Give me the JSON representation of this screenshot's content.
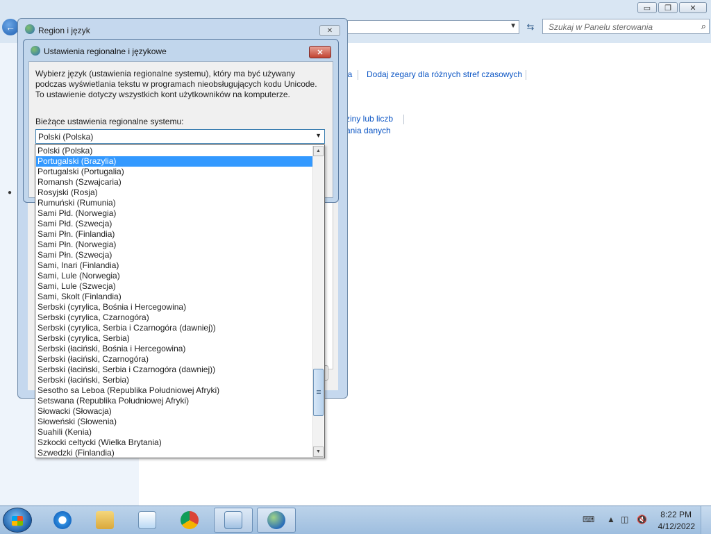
{
  "control_panel": {
    "search_placeholder": "Szukaj w Panelu sterowania",
    "links": {
      "add_clocks": "Dodaj zegary dla różnych stref czasowych",
      "partial_a": "ja",
      "partial_b": "ziny lub liczb",
      "partial_c": "ania danych"
    },
    "window_buttons": {
      "minimize": "▭",
      "restore": "❐",
      "close": "✕"
    }
  },
  "region_dialog": {
    "title": "Region i język",
    "close_glyph": "✕"
  },
  "regional_dialog": {
    "title": "Ustawienia regionalne i językowe",
    "close_glyph": "✕",
    "description": "Wybierz język (ustawienia regionalne systemu), który ma być używany podczas wyświetlania tekstu w programach nieobsługujących kodu Unicode. To ustawienie dotyczy wszystkich kont użytkowników na komputerze.",
    "current_label": "Bieżące ustawienia regionalne systemu:",
    "current_value": "Polski (Polska)"
  },
  "dropdown": {
    "selected_index": 1,
    "options": [
      "Polski (Polska)",
      "Portugalski (Brazylia)",
      "Portugalski (Portugalia)",
      "Romansh (Szwajcaria)",
      "Rosyjski (Rosja)",
      "Rumuński (Rumunia)",
      "Sami Płd. (Norwegia)",
      "Sami Płd. (Szwecja)",
      "Sami Płn. (Finlandia)",
      "Sami Płn. (Norwegia)",
      "Sami Płn. (Szwecja)",
      "Sami, Inari (Finlandia)",
      "Sami, Lule (Norwegia)",
      "Sami, Lule (Szwecja)",
      "Sami, Skolt (Finlandia)",
      "Serbski (cyrylica, Bośnia i Hercegowina)",
      "Serbski (cyrylica, Czarnogóra)",
      "Serbski (cyrylica, Serbia i Czarnogóra (dawniej))",
      "Serbski (cyrylica, Serbia)",
      "Serbski (łaciński, Bośnia i Hercegowina)",
      "Serbski (łaciński, Czarnogóra)",
      "Serbski (łaciński, Serbia i Czarnogóra (dawniej))",
      "Serbski (łaciński, Serbia)",
      "Sesotho sa Leboa (Republika Południowej Afryki)",
      "Setswana (Republika Południowej Afryki)",
      "Słowacki (Słowacja)",
      "Słoweński (Słowenia)",
      "Suahili (Kenia)",
      "Szkocki celtycki (Wielka Brytania)",
      "Szwedzki (Finlandia)"
    ]
  },
  "taskbar": {
    "apps": [
      "internet-explorer",
      "file-explorer",
      "windows-media-player",
      "chrome",
      "control-panel",
      "region-language"
    ],
    "time": "8:22 PM",
    "date": "4/12/2022"
  }
}
